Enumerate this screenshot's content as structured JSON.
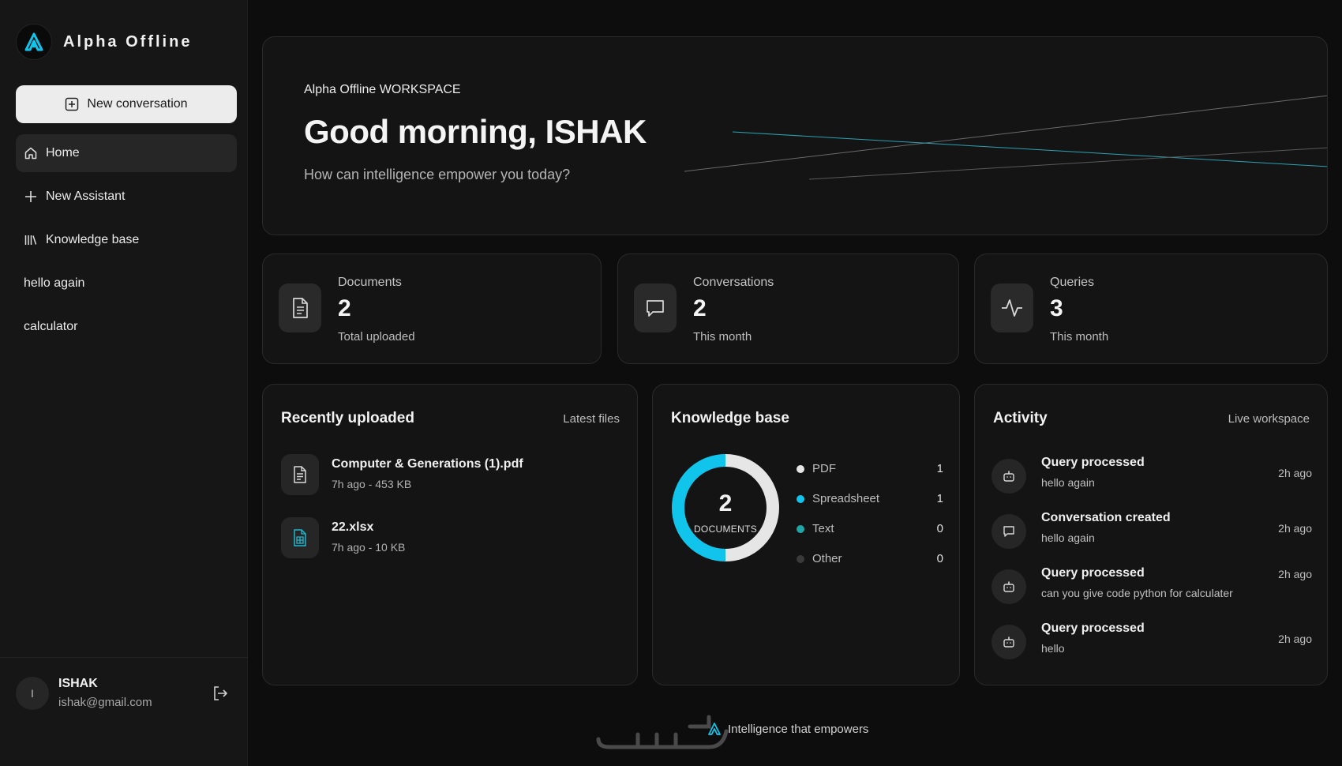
{
  "app": {
    "name": "Alpha Offline"
  },
  "sidebar": {
    "new_conversation_label": "New conversation",
    "items": [
      {
        "label": "Home",
        "icon": "home-icon",
        "active": true
      },
      {
        "label": "New Assistant",
        "icon": "plus-icon",
        "active": false
      },
      {
        "label": "Knowledge base",
        "icon": "library-icon",
        "active": false
      },
      {
        "label": "hello again",
        "icon": "",
        "active": false
      },
      {
        "label": "calculator",
        "icon": "",
        "active": false
      }
    ],
    "user": {
      "initial": "I",
      "name": "ISHAK",
      "email": "ishak@gmail.com"
    }
  },
  "hero": {
    "eyebrow": "Alpha Offline WORKSPACE",
    "title": "Good morning, ISHAK",
    "subtitle": "How can intelligence empower you today?"
  },
  "stats": [
    {
      "label": "Documents",
      "value": "2",
      "sub": "Total uploaded",
      "icon": "document-icon"
    },
    {
      "label": "Conversations",
      "value": "2",
      "sub": "This month",
      "icon": "chat-icon"
    },
    {
      "label": "Queries",
      "value": "3",
      "sub": "This month",
      "icon": "activity-icon"
    }
  ],
  "recent": {
    "title": "Recently uploaded",
    "meta": "Latest files",
    "files": [
      {
        "name": "Computer & Generations (1).pdf",
        "meta": "7h ago - 453 KB",
        "icon": "document-icon"
      },
      {
        "name": "22.xlsx",
        "meta": "7h ago - 10 KB",
        "icon": "spreadsheet-icon"
      }
    ]
  },
  "knowledge": {
    "title": "Knowledge base",
    "total": "2",
    "total_label": "DOCUMENTS",
    "legend": [
      {
        "name": "PDF",
        "value": "1",
        "color": "#e6e6e6"
      },
      {
        "name": "Spreadsheet",
        "value": "1",
        "color": "#11c4ec"
      },
      {
        "name": "Text",
        "value": "0",
        "color": "#1fa7a7"
      },
      {
        "name": "Other",
        "value": "0",
        "color": "#3a3a3a"
      }
    ]
  },
  "chart_data": {
    "type": "pie",
    "categories": [
      "PDF",
      "Spreadsheet",
      "Text",
      "Other"
    ],
    "values": [
      1,
      1,
      0,
      0
    ],
    "title": "",
    "center_value": "2",
    "center_label": "DOCUMENTS"
  },
  "activity": {
    "title": "Activity",
    "meta": "Live workspace",
    "items": [
      {
        "title": "Query processed",
        "sub": "hello again",
        "time": "2h ago",
        "icon": "robot-icon"
      },
      {
        "title": "Conversation created",
        "sub": "hello again",
        "time": "2h ago",
        "icon": "chat-icon"
      },
      {
        "title": "Query processed",
        "sub": "can you give code python for calculater",
        "time": "2h ago",
        "icon": "robot-icon"
      },
      {
        "title": "Query processed",
        "sub": "hello",
        "time": "2h ago",
        "icon": "robot-icon"
      }
    ]
  },
  "footer": {
    "tagline": "Intelligence that empowers"
  },
  "colors": {
    "accent": "#11c4ec",
    "background": "#0d0d0d",
    "card": "#141414"
  }
}
